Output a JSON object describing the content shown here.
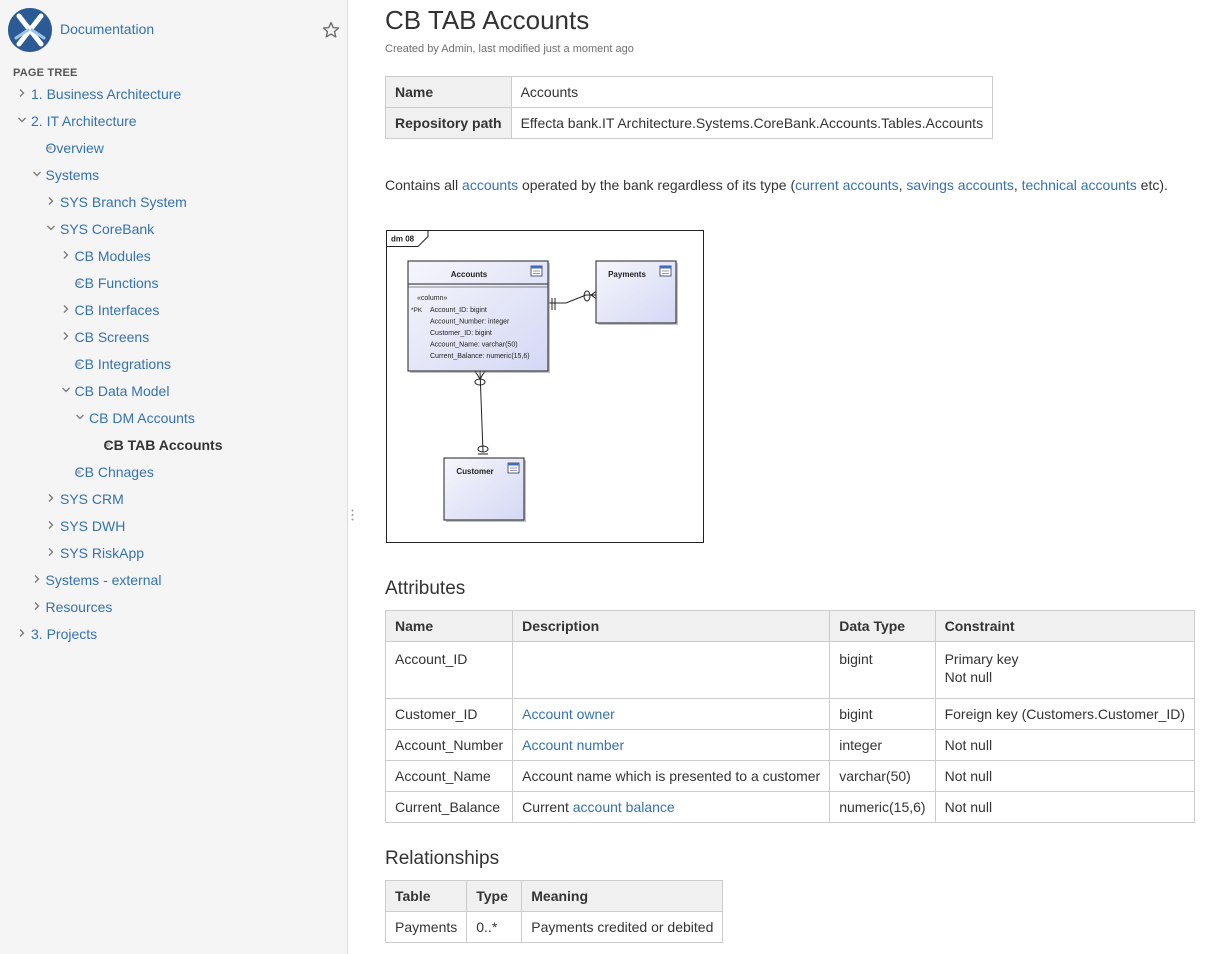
{
  "space": {
    "title": "Documentation"
  },
  "tree": {
    "heading": "PAGE TREE",
    "items": [
      {
        "label": "1. Business Architecture",
        "level": 0,
        "state": "collapsed"
      },
      {
        "label": "2. IT Architecture",
        "level": 0,
        "state": "expanded"
      },
      {
        "label": "Overview",
        "level": 1,
        "state": "leaf"
      },
      {
        "label": "Systems",
        "level": 1,
        "state": "expanded"
      },
      {
        "label": "SYS Branch System",
        "level": 2,
        "state": "collapsed"
      },
      {
        "label": "SYS CoreBank",
        "level": 2,
        "state": "expanded"
      },
      {
        "label": "CB Modules",
        "level": 3,
        "state": "collapsed"
      },
      {
        "label": "CB Functions",
        "level": 3,
        "state": "leaf"
      },
      {
        "label": "CB Interfaces",
        "level": 3,
        "state": "collapsed"
      },
      {
        "label": "CB Screens",
        "level": 3,
        "state": "collapsed"
      },
      {
        "label": "CB Integrations",
        "level": 3,
        "state": "leaf"
      },
      {
        "label": "CB Data Model",
        "level": 3,
        "state": "expanded"
      },
      {
        "label": "CB DM Accounts",
        "level": 4,
        "state": "expanded"
      },
      {
        "label": "CB TAB Accounts",
        "level": 5,
        "state": "leaf",
        "current": true
      },
      {
        "label": "CB Chnages",
        "level": 3,
        "state": "leaf"
      },
      {
        "label": "SYS CRM",
        "level": 2,
        "state": "collapsed"
      },
      {
        "label": "SYS DWH",
        "level": 2,
        "state": "collapsed"
      },
      {
        "label": "SYS RiskApp",
        "level": 2,
        "state": "collapsed"
      },
      {
        "label": "Systems - external",
        "level": 1,
        "state": "collapsed"
      },
      {
        "label": "Resources",
        "level": 1,
        "state": "collapsed"
      },
      {
        "label": "3. Projects",
        "level": 0,
        "state": "collapsed"
      }
    ]
  },
  "page": {
    "title": "CB TAB Accounts",
    "byline": "Created by Admin, last modified just a moment ago"
  },
  "info": {
    "name_label": "Name",
    "name_value": "Accounts",
    "path_label": "Repository path",
    "path_value": "Effecta bank.IT Architecture.Systems.CoreBank.Accounts.Tables.Accounts"
  },
  "description": {
    "t1": "Contains all ",
    "link1": "accounts",
    "t2": " operated by the bank regardless of its type (",
    "link2": "current accounts",
    "t3": ", ",
    "link3": "savings accounts",
    "t4": ", ",
    "link4": "technical accounts",
    "t5": " etc)."
  },
  "diagram": {
    "frame_label": "dm 08",
    "accounts": {
      "title": "Accounts",
      "stereotype": "«column»",
      "pk_marker": "*PK",
      "columns": [
        "Account_ID: bigint",
        "Account_Number: integer",
        "Customer_ID: bigint",
        "Account_Name: varchar(50)",
        "Current_Balance: numeric(15,6)"
      ]
    },
    "payments": {
      "title": "Payments"
    },
    "customer": {
      "title": "Customer"
    }
  },
  "attributes": {
    "heading": "Attributes",
    "headers": [
      "Name",
      "Description",
      "Data Type",
      "Constraint"
    ],
    "rows": [
      {
        "name": "Account_ID",
        "desc_text": "",
        "desc_link": "",
        "type": "bigint",
        "constraint": "Primary key",
        "constraint2": "Not null"
      },
      {
        "name": "Customer_ID",
        "desc_text": "",
        "desc_link": "Account owner",
        "type": "bigint",
        "constraint": "Foreign key (Customers.Customer_ID)",
        "constraint2": ""
      },
      {
        "name": "Account_Number",
        "desc_text": "",
        "desc_link": "Account number",
        "type": "integer",
        "constraint": "Not null",
        "constraint2": ""
      },
      {
        "name": "Account_Name",
        "desc_text": "Account name which is presented to a customer",
        "desc_link": "",
        "type": "varchar(50)",
        "constraint": "Not null",
        "constraint2": ""
      },
      {
        "name": "Current_Balance",
        "desc_text": "Current ",
        "desc_link": "account balance",
        "type": "numeric(15,6)",
        "constraint": "Not null",
        "constraint2": ""
      }
    ]
  },
  "relationships": {
    "heading": "Relationships",
    "headers": [
      "Table",
      "Type",
      "Meaning"
    ],
    "rows": [
      {
        "table": "Payments",
        "type": "0..*",
        "meaning": "Payments credited or debited"
      }
    ]
  }
}
